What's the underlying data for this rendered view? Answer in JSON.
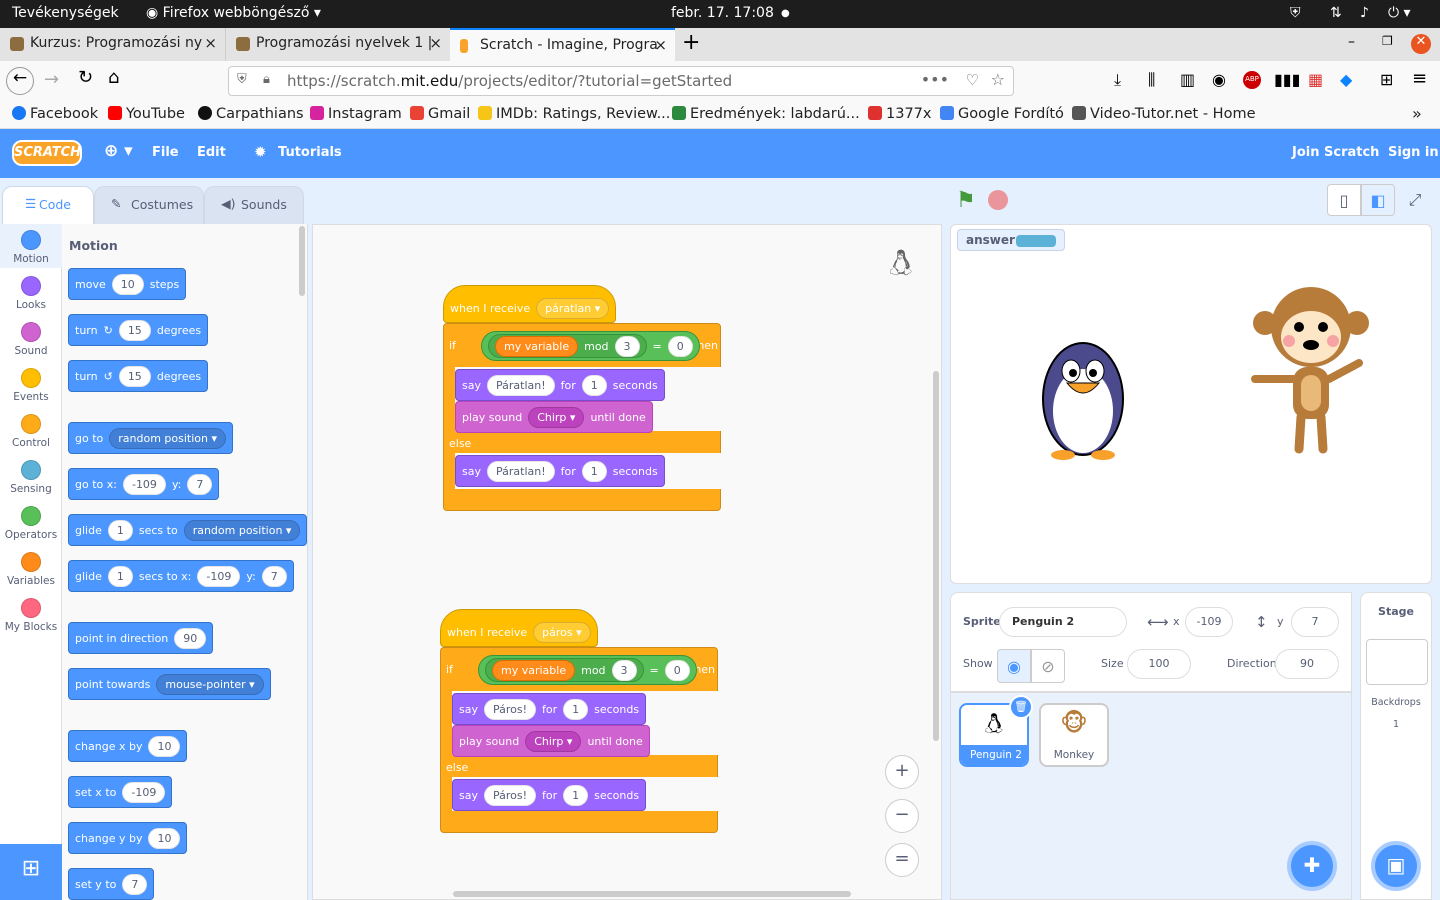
{
  "os": {
    "activities": "Tevékenységek",
    "app": "Firefox webböngésző",
    "clock": "febr. 17.  17:08"
  },
  "tabs": [
    {
      "title": "Kurzus: Programozási ny",
      "close": "×"
    },
    {
      "title": "Programozási nyelvek 1 |",
      "close": "×"
    },
    {
      "title": "Scratch - Imagine, Progra",
      "close": "×"
    }
  ],
  "new_tab": "+",
  "url": {
    "prefix": "https://scratch.",
    "domain": "mit.edu",
    "path": "/projects/editor/?tutorial=getStarted"
  },
  "bookmarks": [
    {
      "label": "Facebook",
      "color": "#1877f2"
    },
    {
      "label": "YouTube",
      "color": "#ff0000"
    },
    {
      "label": "Carpathians",
      "color": "#111111"
    },
    {
      "label": "Instagram",
      "color": "#d6249f"
    },
    {
      "label": "Gmail",
      "color": "#ea4335"
    },
    {
      "label": "IMDb: Ratings, Review...",
      "color": "#f5c518"
    },
    {
      "label": "Eredmények: labdarú...",
      "color": "#2b8a3e"
    },
    {
      "label": "1377x",
      "color": "#e03131"
    },
    {
      "label": "Google Fordító",
      "color": "#4285f4"
    },
    {
      "label": "Video-Tutor.net - Home",
      "color": "#555555"
    }
  ],
  "scratch_menu": {
    "logo": "SCRATCH",
    "file": "File",
    "edit": "Edit",
    "tutorials": "Tutorials",
    "join": "Join Scratch",
    "signin": "Sign in"
  },
  "editor_tabs": {
    "code": "Code",
    "costumes": "Costumes",
    "sounds": "Sounds"
  },
  "categories": [
    {
      "label": "Motion",
      "color": "#4c97ff"
    },
    {
      "label": "Looks",
      "color": "#9966ff"
    },
    {
      "label": "Sound",
      "color": "#cf63cf"
    },
    {
      "label": "Events",
      "color": "#ffbf00"
    },
    {
      "label": "Control",
      "color": "#ffab19"
    },
    {
      "label": "Sensing",
      "color": "#5cb1d6"
    },
    {
      "label": "Operators",
      "color": "#59c059"
    },
    {
      "label": "Variables",
      "color": "#ff8c1a"
    },
    {
      "label": "My Blocks",
      "color": "#ff6680"
    }
  ],
  "palette": {
    "heading": "Motion",
    "move": {
      "a": "move",
      "v": "10",
      "b": "steps"
    },
    "turn_r": {
      "a": "turn",
      "v": "15",
      "b": "degrees"
    },
    "turn_l": {
      "a": "turn",
      "v": "15",
      "b": "degrees"
    },
    "goto": {
      "a": "go to",
      "d": "random position"
    },
    "gotoxy": {
      "a": "go to x:",
      "x": "-109",
      "b": "y:",
      "y": "7"
    },
    "glide1": {
      "a": "glide",
      "v": "1",
      "b": "secs to",
      "d": "random position"
    },
    "glide2": {
      "a": "glide",
      "v": "1",
      "b": "secs to x:",
      "x": "-109",
      "c": "y:",
      "y": "7"
    },
    "point_dir": {
      "a": "point in direction",
      "v": "90"
    },
    "point_towards": {
      "a": "point towards",
      "d": "mouse-pointer"
    },
    "change_x": {
      "a": "change x by",
      "v": "10"
    },
    "set_x": {
      "a": "set x to",
      "v": "-109"
    },
    "change_y": {
      "a": "change y by",
      "v": "10"
    },
    "set_y": {
      "a": "set y to",
      "v": "7"
    }
  },
  "script1": {
    "hat": "when I receive",
    "msg": "páratlan",
    "if": "if",
    "var": "my variable",
    "mod": "mod",
    "n": "3",
    "eq": "=",
    "z": "0",
    "then": "then",
    "say1": {
      "a": "say",
      "t": "Páratlan!",
      "b": "for",
      "v": "1",
      "c": "seconds"
    },
    "sound": {
      "a": "play sound",
      "d": "Chirp",
      "b": "until done"
    },
    "else": "else",
    "say2": {
      "a": "say",
      "t": "Páratlan!",
      "b": "for",
      "v": "1",
      "c": "seconds"
    }
  },
  "script2": {
    "hat": "when I receive",
    "msg": "páros",
    "if": "if",
    "var": "my variable",
    "mod": "mod",
    "n": "3",
    "eq": "=",
    "z": "0",
    "then": "then",
    "say1": {
      "a": "say",
      "t": "Páros!",
      "b": "for",
      "v": "1",
      "c": "seconds"
    },
    "sound": {
      "a": "play sound",
      "d": "Chirp",
      "b": "until done"
    },
    "else": "else",
    "say2": {
      "a": "say",
      "t": "Páros!",
      "b": "for",
      "v": "1",
      "c": "seconds"
    }
  },
  "zoom": {
    "in": "+",
    "out": "−",
    "reset": "="
  },
  "stage": {
    "monitor_label": "answer"
  },
  "sprite_info": {
    "sprite_label": "Sprite",
    "sprite_name": "Penguin 2",
    "x_label": "x",
    "x": "-109",
    "y_label": "y",
    "y": "7",
    "show_label": "Show",
    "size_label": "Size",
    "size": "100",
    "direction_label": "Direction",
    "direction": "90"
  },
  "sprites": [
    {
      "name": "Penguin 2"
    },
    {
      "name": "Monkey"
    }
  ],
  "stage_panel": {
    "title": "Stage",
    "backdrops_label": "Backdrops",
    "backdrops_count": "1"
  }
}
